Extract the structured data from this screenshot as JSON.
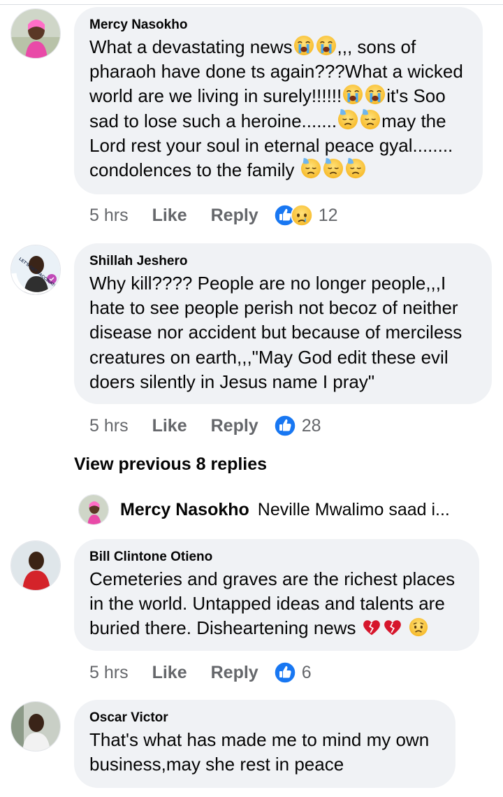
{
  "comments": [
    {
      "author": "Mercy Nasokho",
      "text_lines": [
        "What a devastating news",
        ",,, sons of",
        "pharaoh have done ts again???What a wicked",
        "world are we living in surely!!!!!!",
        "it's Soo",
        "sad to lose such a heroine.......",
        "may the",
        "Lord rest your soul in eternal peace gyal........",
        "condolences to the family"
      ],
      "time": "5 hrs",
      "like_label": "Like",
      "reply_label": "Reply",
      "reaction_count": "12",
      "reactions": [
        "like-icon",
        "sad-icon"
      ]
    },
    {
      "author": "Shillah Jeshero",
      "text": "Why kill???? People are no longer people,,,I\nhate to see people perish not becoz of neither\ndisease nor accident but because of merciless\ncreatures on earth,,,\"May God edit these evil\ndoers silently in Jesus name I pray\"",
      "avatar_badge": "LET'S GET VACCINATED",
      "time": "5 hrs",
      "like_label": "Like",
      "reply_label": "Reply",
      "reaction_count": "28",
      "reactions": [
        "like-icon"
      ]
    },
    {
      "author": "Bill Clintone Otieno",
      "text_lines": [
        "Cemeteries and graves are the richest places",
        "in the world. Untapped ideas and talents are",
        "buried there. Disheartening news"
      ],
      "time": "5 hrs",
      "like_label": "Like",
      "reply_label": "Reply",
      "reaction_count": "6",
      "reactions": [
        "like-icon"
      ]
    },
    {
      "author": "Oscar Victor",
      "text": "That's what has made me to mind my own\nbusiness,may she rest in peace"
    }
  ],
  "view_previous": "View previous 8 replies",
  "reply_preview": {
    "author": "Mercy Nasokho",
    "text": "Neville Mwalimo saad i..."
  },
  "colors": {
    "bubble": "#f0f2f5",
    "muted": "#65676b",
    "like_blue": "#1877f2",
    "text": "#050505"
  }
}
